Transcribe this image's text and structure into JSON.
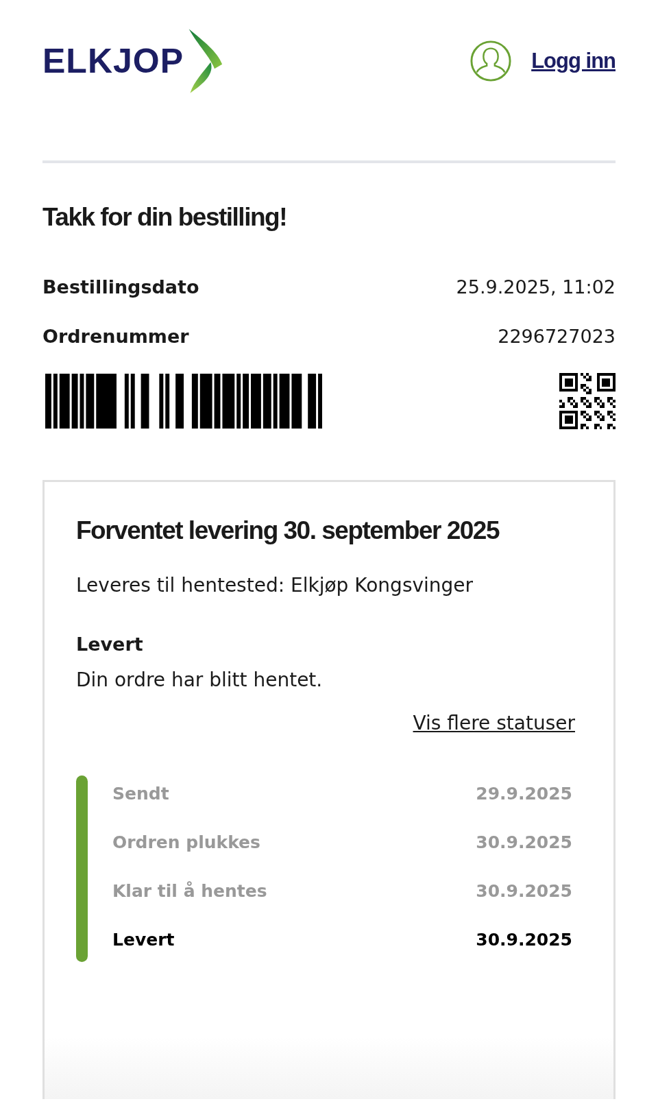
{
  "header": {
    "logo": "ELKJOP",
    "login": "Logg inn"
  },
  "title": "Takk for din bestilling!",
  "details": [
    {
      "label": "Bestillingsdato",
      "value": "25.9.2025, 11:02"
    },
    {
      "label": "Ordrenummer",
      "value": "2296727023"
    }
  ],
  "delivery": {
    "heading": "Forventet levering 30. september 2025",
    "destination": "Leveres til hentested: Elkjøp Kongsvinger",
    "status_title": "Levert",
    "status_text": "Din ordre har blitt hentet.",
    "more_link": "Vis flere statuser",
    "timeline": [
      {
        "label": "Sendt",
        "date": "29.9.2025",
        "current": false
      },
      {
        "label": "Ordren plukkes",
        "date": "30.9.2025",
        "current": false
      },
      {
        "label": "Klar til å hentes",
        "date": "30.9.2025",
        "current": false
      },
      {
        "label": "Levert",
        "date": "30.9.2025",
        "current": true
      }
    ]
  }
}
